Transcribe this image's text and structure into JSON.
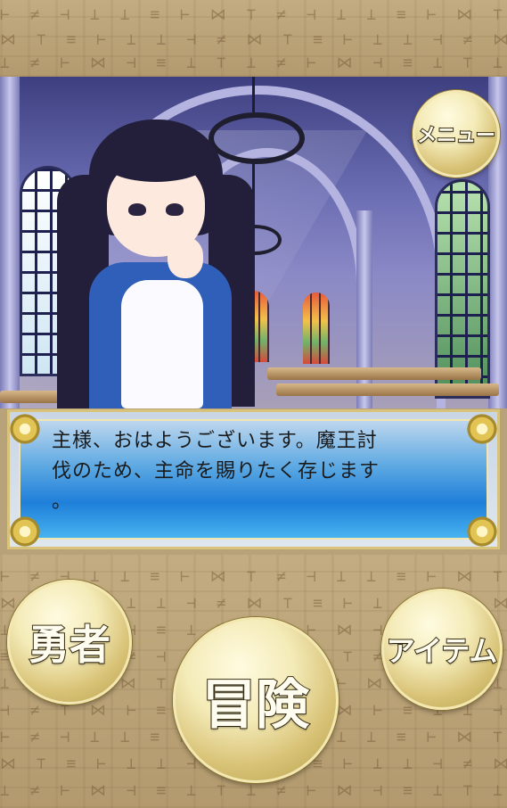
{
  "dialog": {
    "line1": "主様、おはようございます。魔王討",
    "line2": "伐のため、主命を賜りたく存じます",
    "line3": "。"
  },
  "buttons": {
    "menu": "メニュー",
    "hero": "勇者",
    "adventure": "冒険",
    "item": "アイテム"
  },
  "colors": {
    "parchment": "#b8a27a",
    "dialog_blue": "#1f7fd9",
    "button_gold": "#d8c276",
    "button_text_outline": "#3b2f12"
  },
  "scene": {
    "background": "church-interior",
    "character": "maid"
  }
}
